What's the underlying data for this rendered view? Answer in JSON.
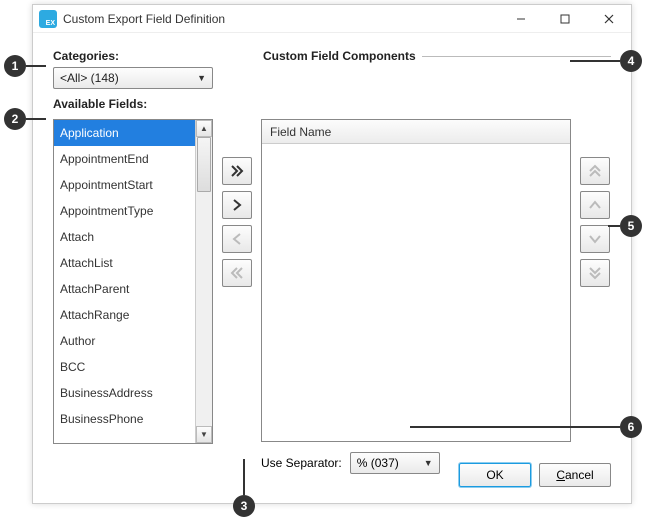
{
  "window": {
    "title": "Custom Export Field Definition"
  },
  "labels": {
    "categories": "Categories:",
    "available_fields": "Available Fields:",
    "custom_components": "Custom Field Components",
    "field_name_header": "Field Name",
    "use_separator": "Use Separator:"
  },
  "categories_dropdown": {
    "selected": "<All> (148)"
  },
  "available_fields": [
    "Application",
    "AppointmentEnd",
    "AppointmentStart",
    "AppointmentType",
    "Attach",
    "AttachList",
    "AttachParent",
    "AttachRange",
    "Author",
    "BCC",
    "BusinessAddress",
    "BusinessPhone"
  ],
  "separator_dropdown": {
    "selected": "% (037)"
  },
  "buttons": {
    "ok": "OK",
    "cancel": "Cancel"
  },
  "callouts": {
    "c1": "1",
    "c2": "2",
    "c3": "3",
    "c4": "4",
    "c5": "5",
    "c6": "6"
  }
}
